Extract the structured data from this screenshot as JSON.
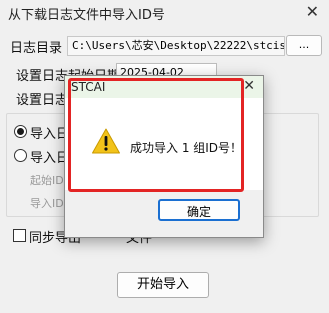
{
  "window": {
    "title": "从下载日志文件中导入ID号",
    "close_glyph": "✕"
  },
  "form": {
    "log_dir_label": "日志目录",
    "log_dir_value": "C:\\Users\\芯安\\Desktop\\22222\\stcisp",
    "browse_label": "...",
    "start_date_label": "设置日志起始日期",
    "start_date_value": "2025-04-02",
    "end_date_label": "设置日志",
    "radio1_label": "导入日",
    "radio2_label": "导入日",
    "start_id_label": "起始ID",
    "import_id_label": "导入ID",
    "sync_checkbox_label": "同步导出",
    "sync_checkbox_tail": "文件",
    "start_import_label": "开始导入"
  },
  "dialog": {
    "title": "STCAI",
    "close_glyph": "✕",
    "message": "成功导入 1 组ID号！",
    "ok_label": "确定",
    "icon": "warning-icon"
  },
  "colors": {
    "highlight": "#e32424",
    "dialog_titlebar": "#ebf5e8",
    "ok_border": "#1a6fd1"
  }
}
